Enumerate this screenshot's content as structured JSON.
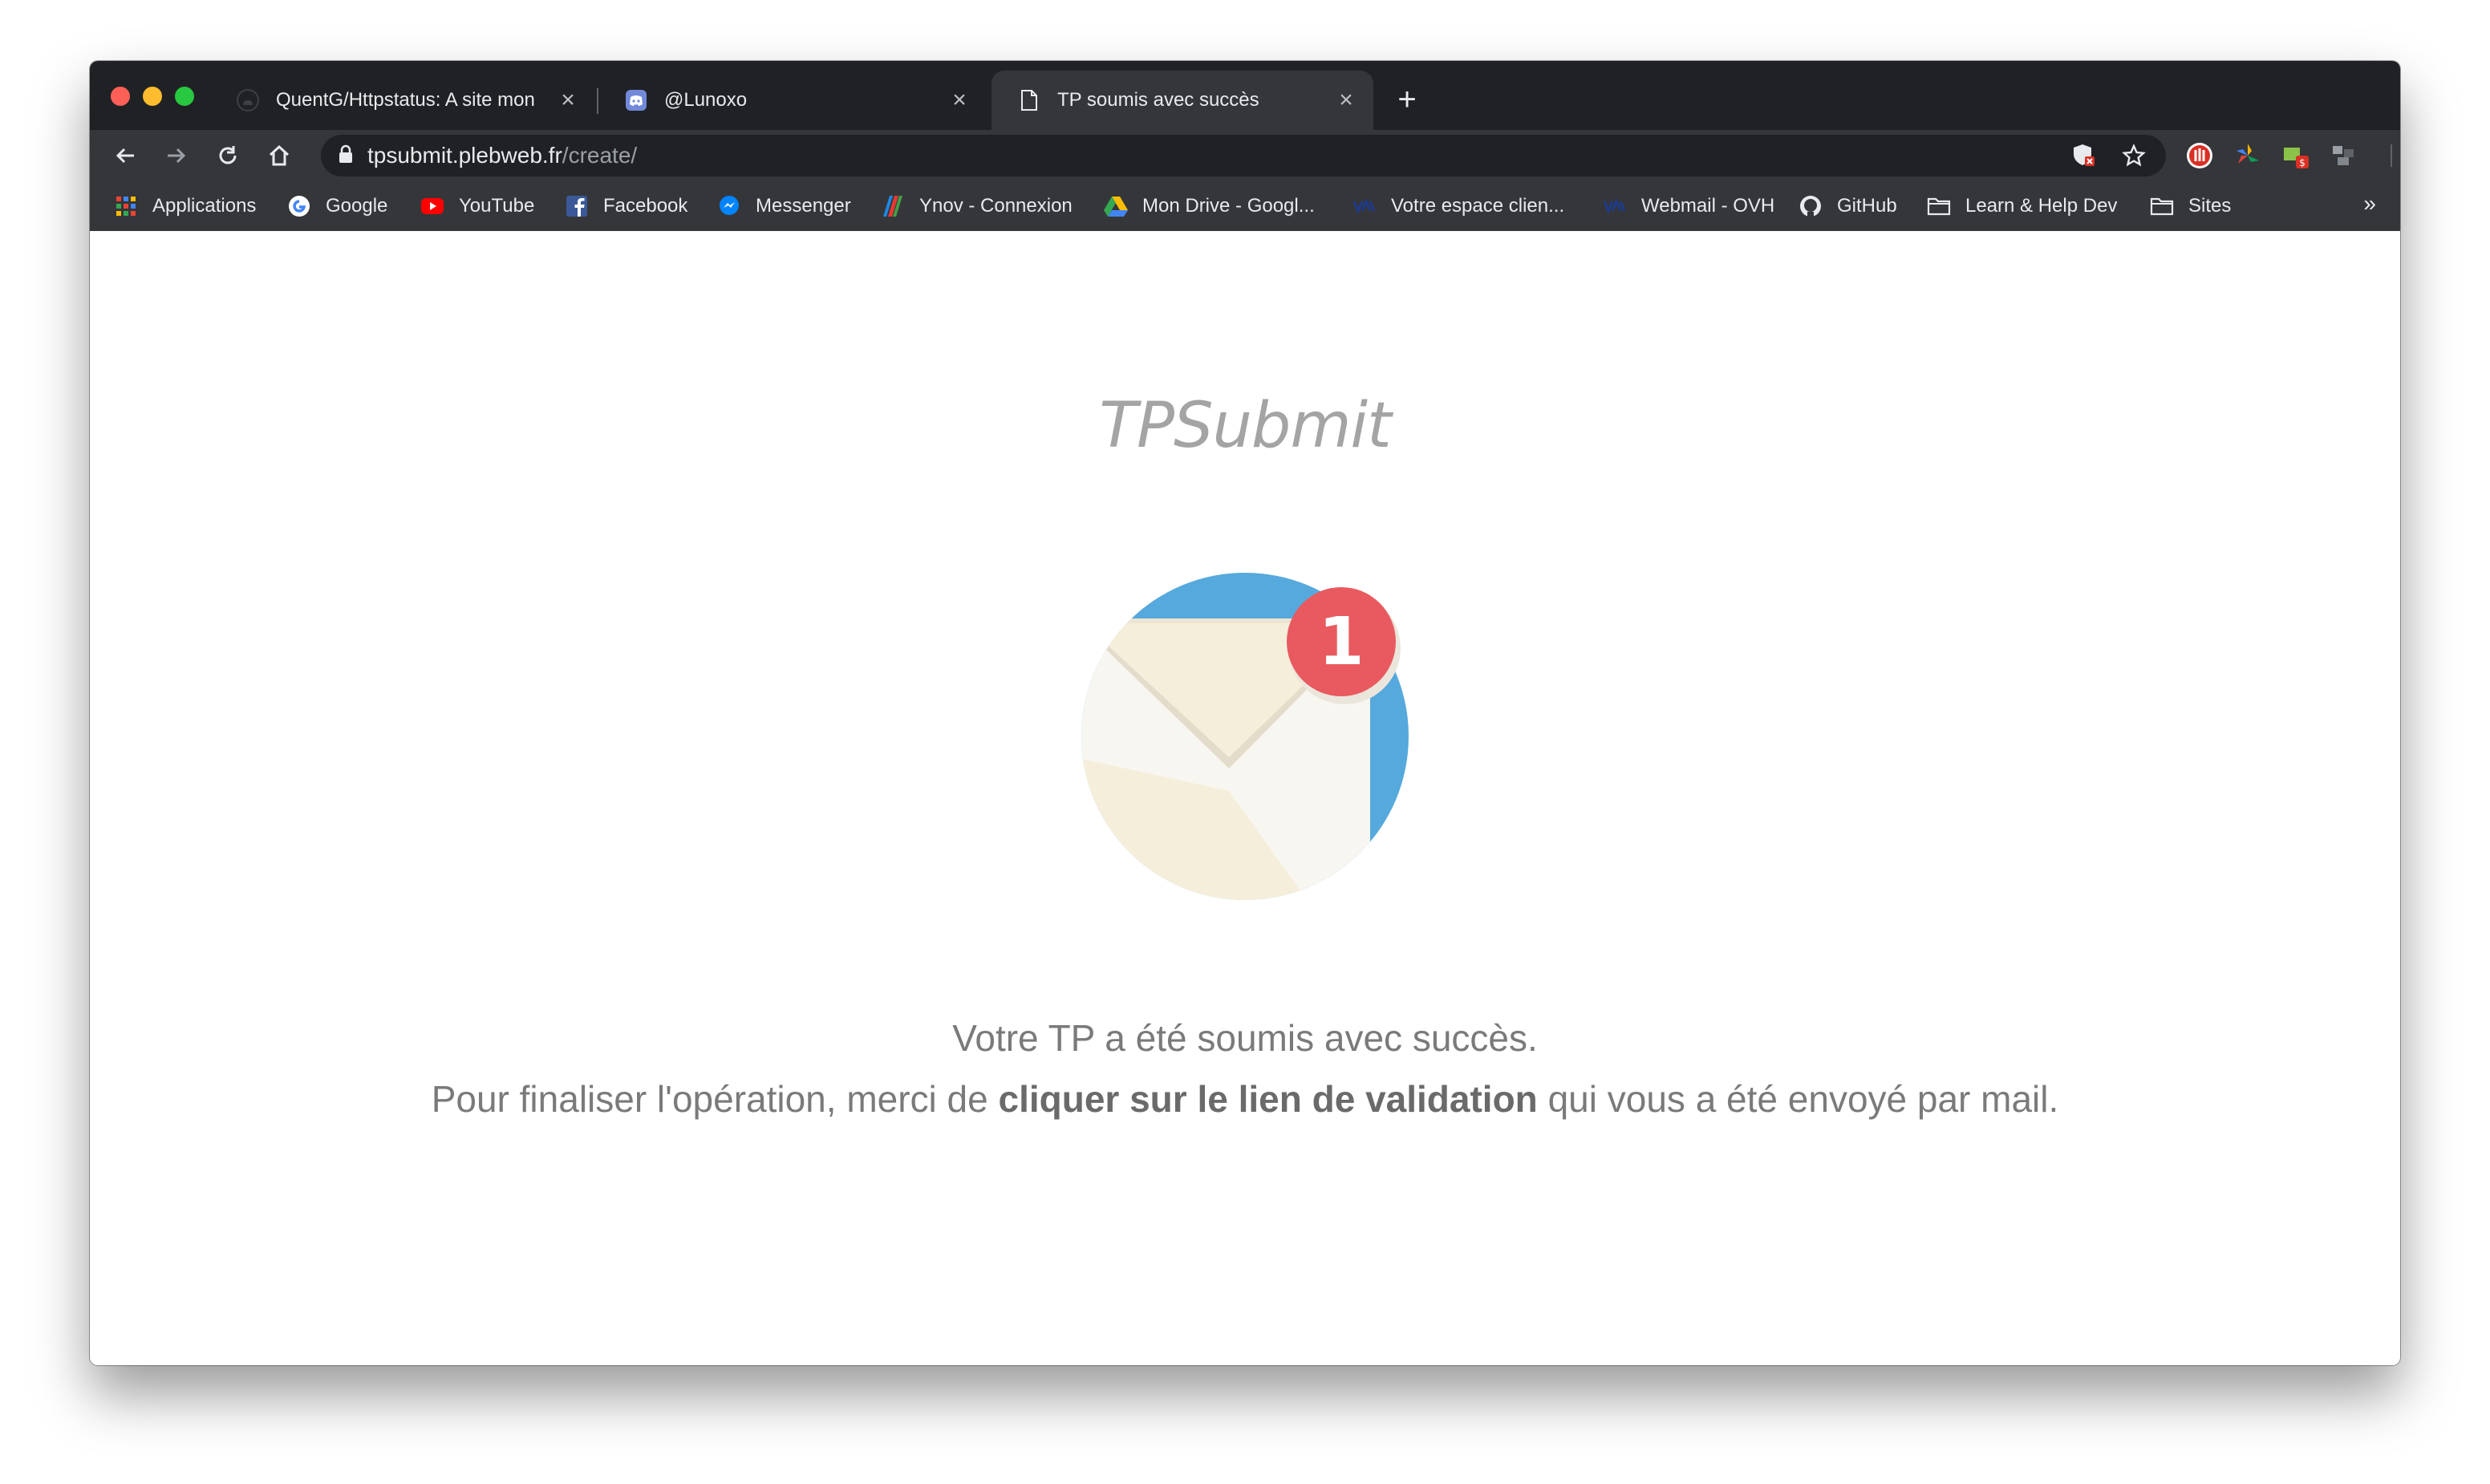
{
  "tabs": [
    {
      "title": "QuentG/Httpstatus: A site mon",
      "favicon": "github-icon",
      "active": false
    },
    {
      "title": "@Lunoxo",
      "favicon": "discord-icon",
      "active": false
    },
    {
      "title": "TP soumis avec succès",
      "favicon": "document-icon",
      "active": true
    }
  ],
  "address_bar": {
    "host": "tpsubmit.plebweb.fr",
    "path": "/create/"
  },
  "bookmarks": [
    {
      "label": "Applications",
      "icon": "apps-grid-icon"
    },
    {
      "label": "Google",
      "icon": "google-icon"
    },
    {
      "label": "YouTube",
      "icon": "youtube-icon"
    },
    {
      "label": "Facebook",
      "icon": "facebook-icon"
    },
    {
      "label": "Messenger",
      "icon": "messenger-icon"
    },
    {
      "label": "Ynov - Connexion",
      "icon": "ynov-icon"
    },
    {
      "label": "Mon Drive - Googl...",
      "icon": "google-drive-icon"
    },
    {
      "label": "Votre espace clien...",
      "icon": "ovh-icon"
    },
    {
      "label": "Webmail - OVH",
      "icon": "ovh-icon"
    },
    {
      "label": "GitHub",
      "icon": "github-icon"
    },
    {
      "label": "Learn & Help Dev",
      "icon": "folder-icon"
    },
    {
      "label": "Sites",
      "icon": "folder-icon"
    }
  ],
  "bookmarks_overflow": "»",
  "page": {
    "brand": "TPSubmit",
    "notification_count": "1",
    "message_line1": "Votre TP a été soumis avec succès.",
    "message_line2_before": "Pour finaliser l'opération, merci de ",
    "message_line2_bold": "cliquer sur le lien de validation",
    "message_line2_after": " qui vous a été envoyé par mail."
  },
  "colors": {
    "tab_strip": "#202124",
    "toolbar": "#35363a",
    "envelope_circle": "#56a9dc",
    "badge": "#e85a5f",
    "text": "#7a7a7a"
  }
}
